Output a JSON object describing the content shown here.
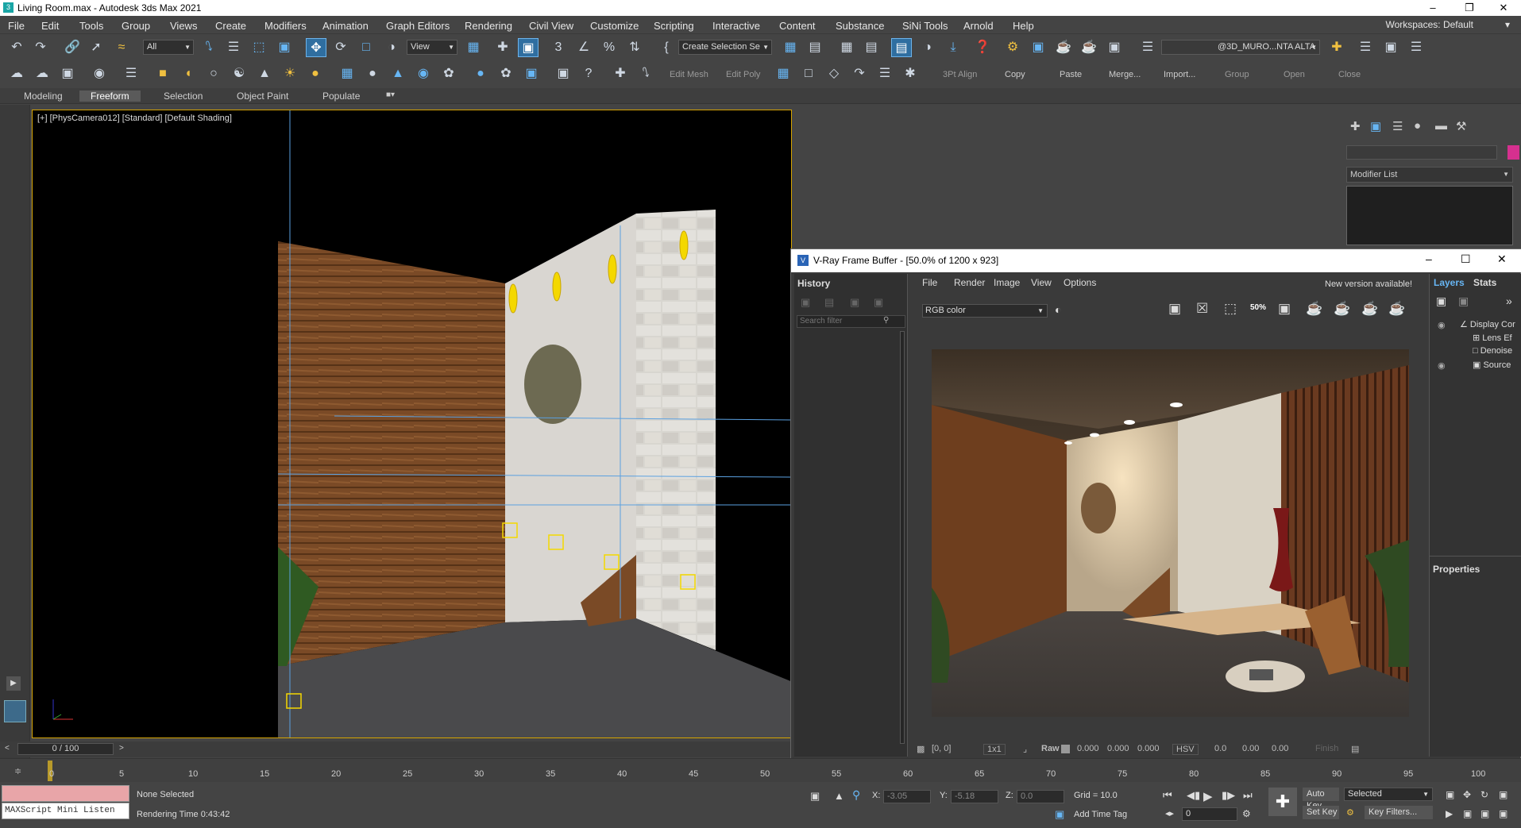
{
  "window": {
    "title": "Living Room.max - Autodesk 3ds Max 2021",
    "icon": "3ds-max-icon"
  },
  "menu": {
    "items": [
      "File",
      "Edit",
      "Tools",
      "Group",
      "Views",
      "Create",
      "Modifiers",
      "Animation",
      "Graph Editors",
      "Rendering",
      "Civil View",
      "Customize",
      "Scripting",
      "Interactive",
      "Content",
      "Substance",
      "SiNi Tools",
      "Arnold",
      "Help"
    ],
    "workspace_label": "Workspaces:",
    "workspace_value": "Default"
  },
  "toolbar": {
    "selection_filter": "All",
    "ref_coord": "View",
    "named_selection": "Create Selection Se",
    "layer": "@3D_MURO...NTA ALTA",
    "row2_labels": {
      "edit_mesh": "Edit Mesh",
      "edit_poly": "Edit Poly",
      "align": "3Pt Align",
      "copy": "Copy",
      "paste": "Paste",
      "merge": "Merge...",
      "import": "Import...",
      "group": "Group",
      "open": "Open",
      "close": "Close"
    }
  },
  "ribbon": {
    "tabs": [
      "Modeling",
      "Freeform",
      "Selection",
      "Object Paint",
      "Populate"
    ],
    "active": "Freeform"
  },
  "viewport": {
    "label": "[+] [PhysCamera012] [Standard] [Default Shading]"
  },
  "command_panel": {
    "modifier_list": "Modifier List",
    "accent_color": "#d6308f"
  },
  "vfb": {
    "title": "V-Ray Frame Buffer - [50.0% of 1200 x 923]",
    "history_label": "History",
    "search_placeholder": "Search filter",
    "menu": [
      "File",
      "Render",
      "Image",
      "View",
      "Options"
    ],
    "new_version": "New version available!",
    "channel": "RGB color",
    "zoom": "50%",
    "status": {
      "coords": "[0, 0]",
      "scale": "1x1",
      "raw": "Raw",
      "r": "0.000",
      "g": "0.000",
      "b": "0.000",
      "mode": "HSV",
      "h": "0.0",
      "s": "0.00",
      "v": "0.00",
      "finish": "Finish"
    },
    "right_tabs": [
      "Layers",
      "Stats"
    ],
    "layers": [
      "Display Cor",
      "Lens Ef",
      "Denoise",
      "Source"
    ],
    "properties": "Properties"
  },
  "time": {
    "slider": "0 / 100",
    "ticks": [
      "0",
      "5",
      "10",
      "15",
      "20",
      "25",
      "30",
      "35",
      "40",
      "45",
      "50",
      "55",
      "60",
      "65",
      "70",
      "75",
      "80",
      "85",
      "90",
      "95",
      "100"
    ]
  },
  "status": {
    "maxscript": "MAXScript Mini Listen",
    "selection": "None Selected",
    "render_time": "Rendering Time  0:43:42",
    "x_label": "X:",
    "x": "-3.05",
    "y_label": "Y:",
    "y": "-5.18",
    "z_label": "Z:",
    "z": "0.0",
    "grid": "Grid = 10.0",
    "add_time_tag": "Add Time Tag",
    "auto_key": "Auto Key",
    "set_key": "Set Key",
    "key_mode": "Selected",
    "frame": "0",
    "key_filters": "Key Filters..."
  }
}
